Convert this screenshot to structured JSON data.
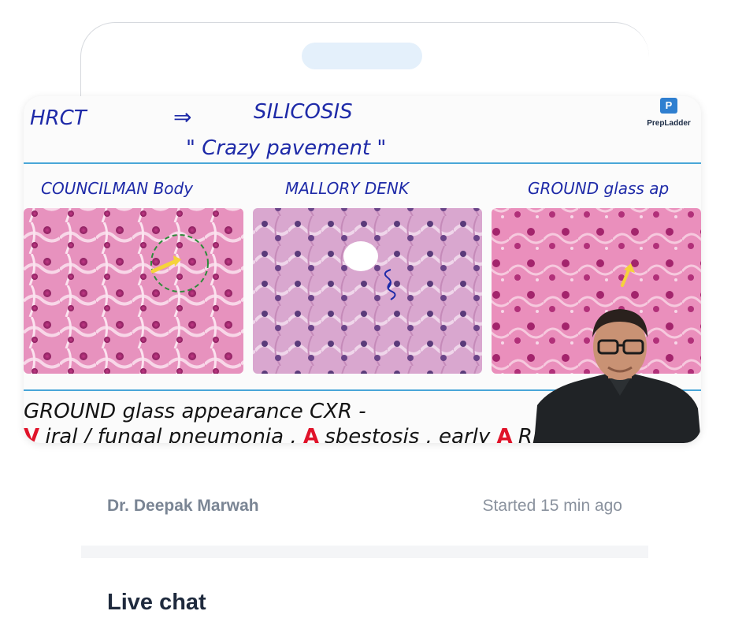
{
  "device": {
    "notch_color": "#e4f0fb"
  },
  "video": {
    "brand": {
      "name": "PrepLadder",
      "icon": "prepladder-logo-icon",
      "icon_glyph": "P",
      "color": "#2f7fd0"
    },
    "whiteboard": {
      "line1_left": "HRCT",
      "line1_arrow": "⇒",
      "line1_right": "SILICOSIS",
      "line2": "\" Crazy pavement \"",
      "panel_labels": [
        "COUNCILMAN Body",
        "MALLORY DENK",
        "GROUND glass ap"
      ],
      "bottom_line1": "GROUND glass appearance CXR -",
      "bottom_line2_parts": [
        "V",
        "iral / fungal pneumonia , ",
        "A",
        "sbestosis , early ",
        "A",
        "RDS"
      ]
    },
    "colors": {
      "ink_blue": "#1e2aa8",
      "ink_red": "#e0132a",
      "rule_line": "#4aa6d8",
      "tissue_pink": "#e58bb8",
      "tissue_lilac": "#d8a9cf"
    },
    "presenter": "presenter-video-overlay"
  },
  "session": {
    "instructor": "Dr. Deepak Marwah",
    "started": "Started 15 min ago"
  },
  "chat": {
    "title": "Live chat"
  }
}
